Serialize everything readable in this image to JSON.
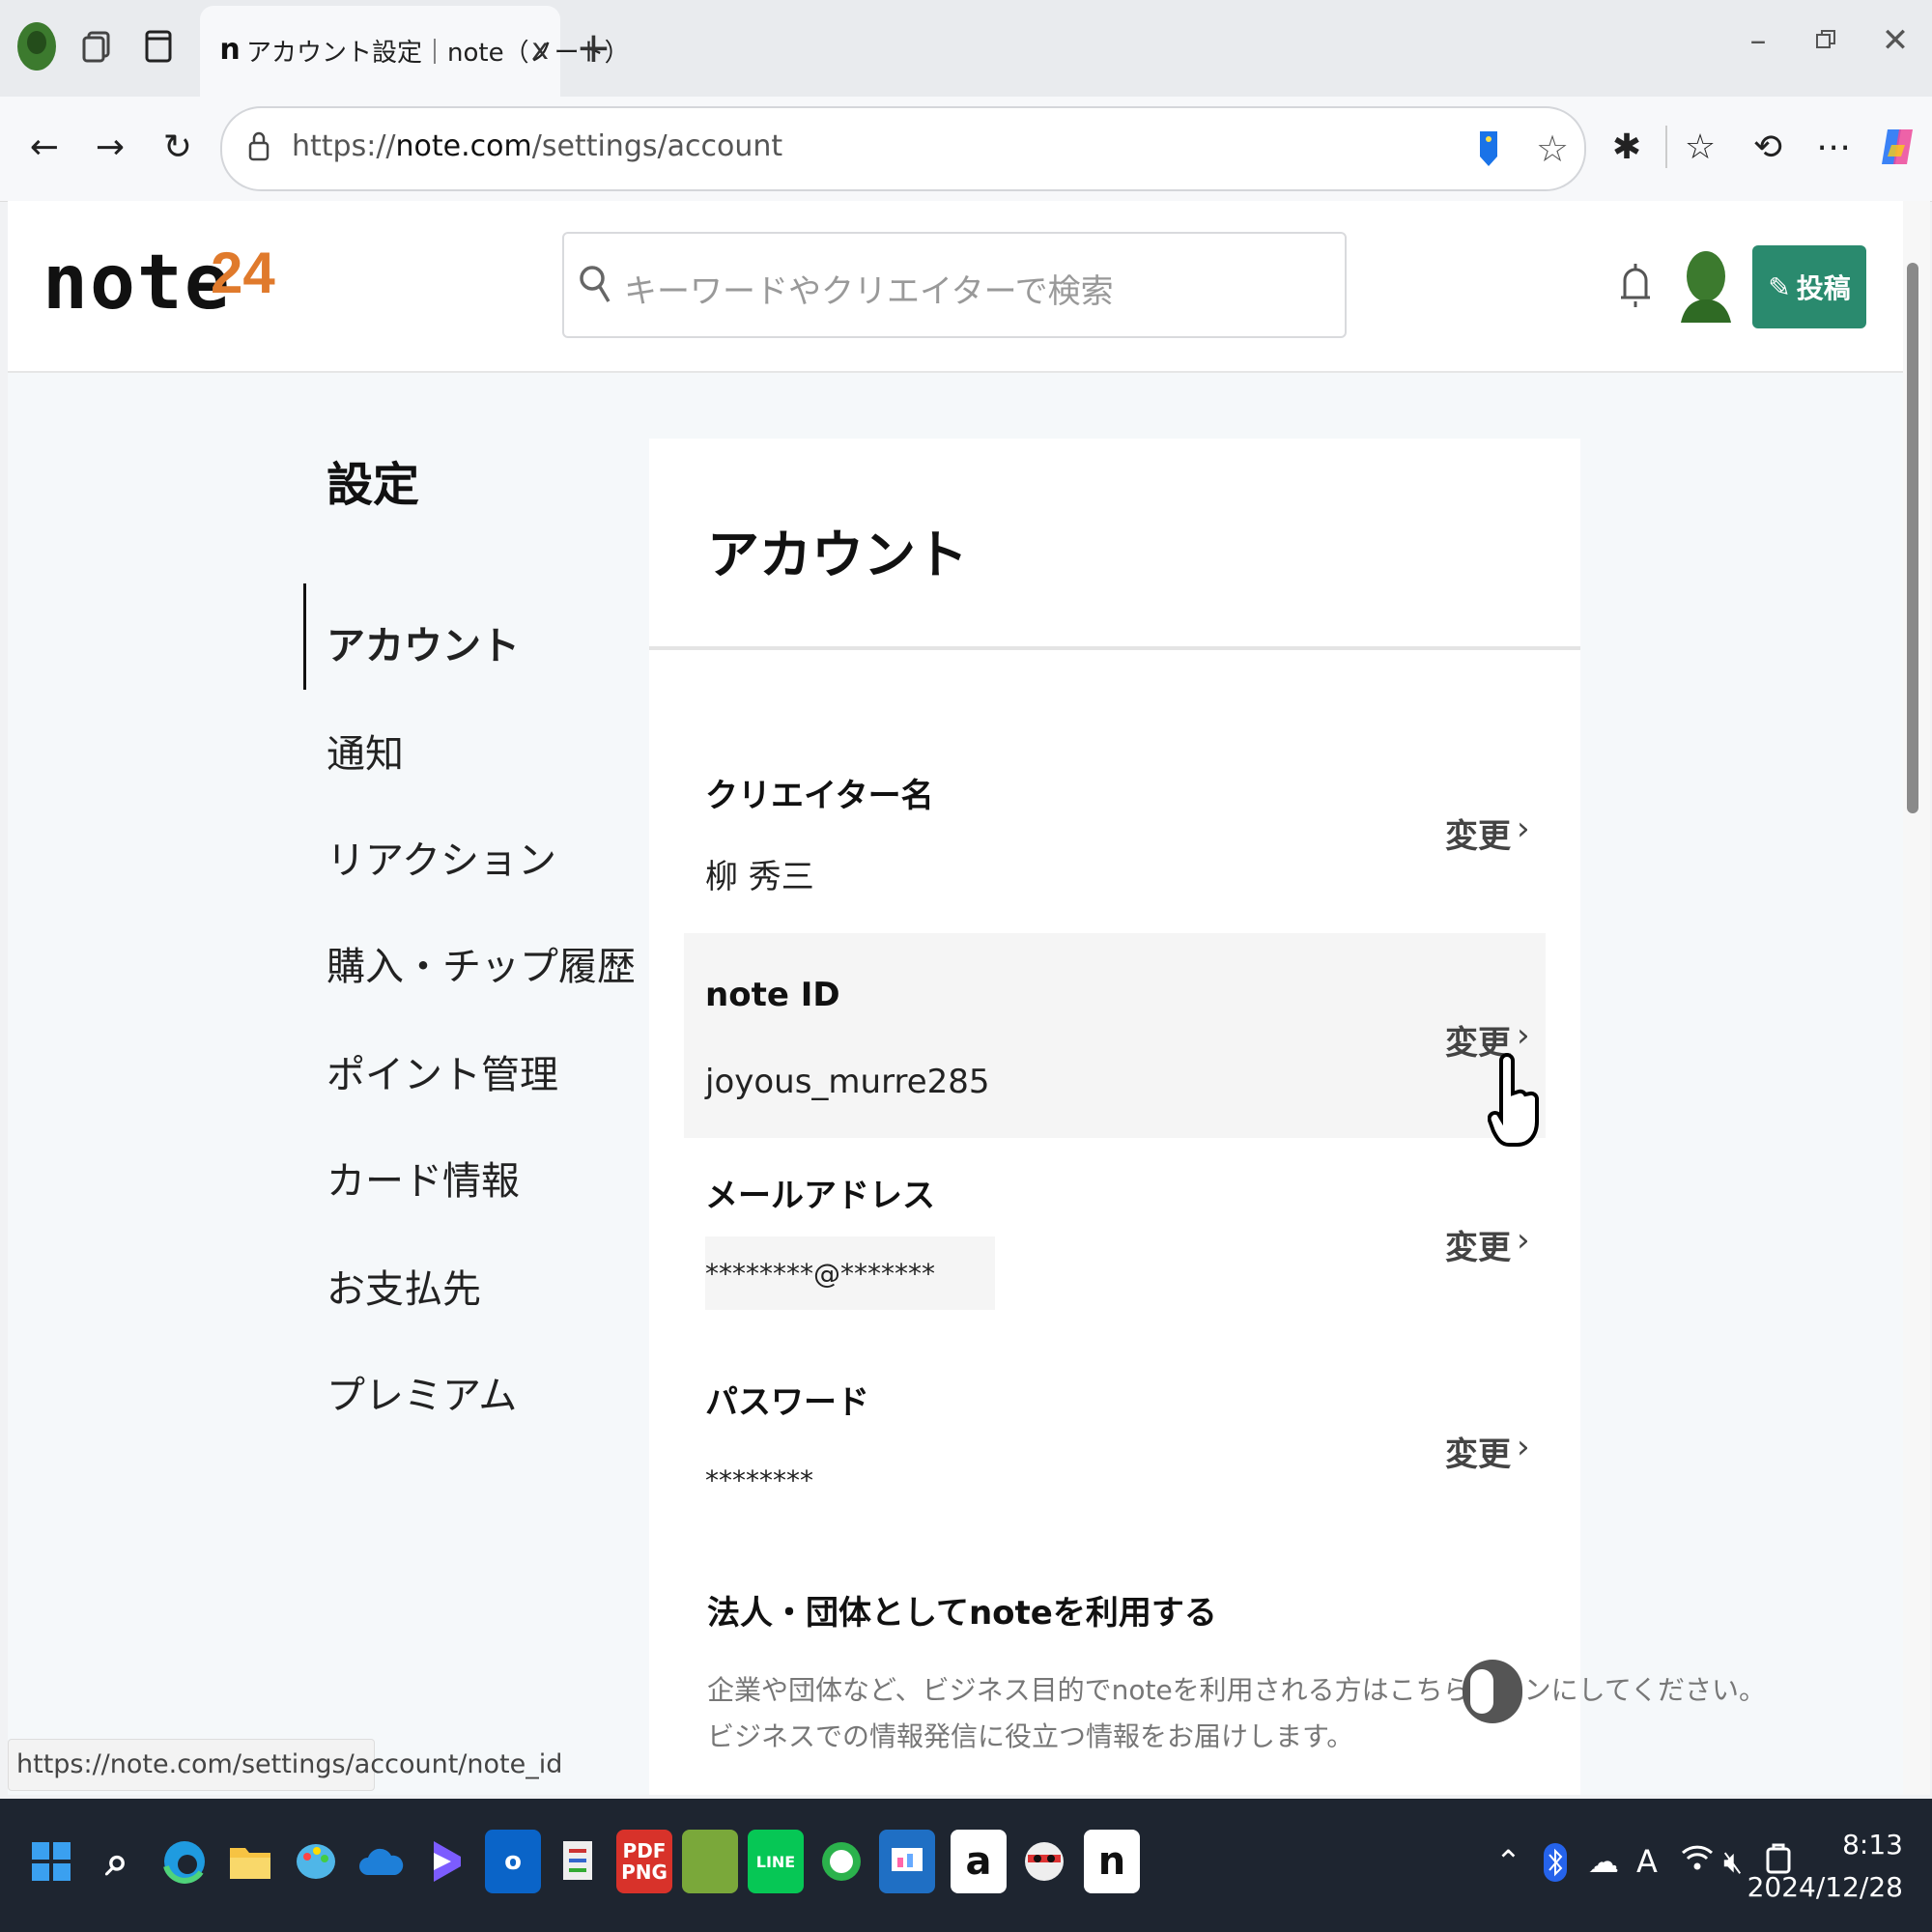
{
  "browser": {
    "tab_title": "アカウント設定｜note（ノート）",
    "tab_close": "x",
    "new_tab": "+",
    "url_prefix": "https://",
    "url_host": "note.com",
    "url_path": "/settings/account",
    "status_url": "https://note.com/settings/account/note_id"
  },
  "header": {
    "logo": "note",
    "logo_badge": "24",
    "search_placeholder": "キーワードやクリエイターで検索",
    "post_label": "投稿"
  },
  "sidebar": {
    "title": "設定",
    "items": [
      {
        "label": "アカウント",
        "active": true
      },
      {
        "label": "通知"
      },
      {
        "label": "リアクション"
      },
      {
        "label": "購入・チップ履歴"
      },
      {
        "label": "ポイント管理"
      },
      {
        "label": "カード情報"
      },
      {
        "label": "お支払先"
      },
      {
        "label": "プレミアム"
      }
    ]
  },
  "account": {
    "title": "アカウント",
    "change_label": "変更",
    "chevron": "›",
    "fields": {
      "creator_name": {
        "label": "クリエイター名",
        "value": "柳 秀三"
      },
      "note_id": {
        "label": "note ID",
        "value": "joyous_murre285"
      },
      "email": {
        "label": "メールアドレス",
        "value": "********@*******"
      },
      "password": {
        "label": "パスワード",
        "value": "********"
      }
    },
    "corporate": {
      "title": "法人・団体としてnoteを利用する",
      "desc_line1": "企業や団体など、ビジネス目的でnoteを利用される方はこちらをオンにしてください。",
      "desc_line2": "ビジネスでの情報発信に役立つ情報をお届けします。",
      "enabled": false
    }
  },
  "taskbar": {
    "pdf_label": "PDF PNG",
    "outlook_label": "o",
    "amazon_label": "a",
    "note_label": "n",
    "time": "8:13",
    "date": "2024/12/28"
  },
  "colors": {
    "accent": "#2a8a6e",
    "taskbar": "#1e2530"
  }
}
